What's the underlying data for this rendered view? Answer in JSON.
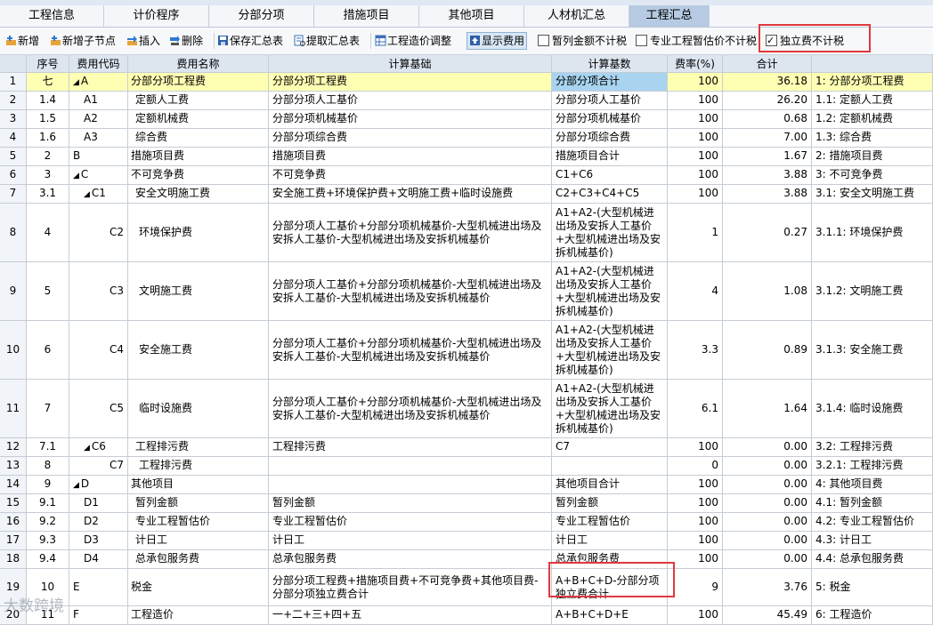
{
  "tabs": [
    "工程信息",
    "计价程序",
    "分部分项",
    "措施项目",
    "其他项目",
    "人材机汇总",
    "工程汇总"
  ],
  "active_tab": 6,
  "toolbar": {
    "add": "新增",
    "add_child": "新增子节点",
    "insert": "插入",
    "delete": "删除",
    "save_summary": "保存汇总表",
    "extract_summary": "提取汇总表",
    "cost_adjust": "工程造价调整",
    "show_fee": "显示费用",
    "provisional_no_tax": "暂列金额不计税",
    "special_no_tax": "专业工程暂估价不计税",
    "independent_no_tax": "独立费不计税"
  },
  "columns": [
    "序号",
    "费用代码",
    "费用名称",
    "计算基础",
    "计算基数",
    "费率(%)",
    "合计"
  ],
  "rows": [
    {
      "rn": "1",
      "seq": "七",
      "code": "A",
      "name": "分部分项工程费",
      "basis": "分部分项工程费",
      "base": "分部分项合计",
      "rate": "100",
      "total": "36.18",
      "desc": "1: 分部分项工程费",
      "indent": 0,
      "tri": "◢",
      "hl": true
    },
    {
      "rn": "2",
      "seq": "1.4",
      "code": "A1",
      "name": "定额人工费",
      "basis": "分部分项人工基价",
      "base": "分部分项人工基价",
      "rate": "100",
      "total": "26.20",
      "desc": "1.1: 定额人工费",
      "indent": 1
    },
    {
      "rn": "3",
      "seq": "1.5",
      "code": "A2",
      "name": "定额机械费",
      "basis": "分部分项机械基价",
      "base": "分部分项机械基价",
      "rate": "100",
      "total": "0.68",
      "desc": "1.2: 定额机械费",
      "indent": 1
    },
    {
      "rn": "4",
      "seq": "1.6",
      "code": "A3",
      "name": "综合费",
      "basis": "分部分项综合费",
      "base": "分部分项综合费",
      "rate": "100",
      "total": "7.00",
      "desc": "1.3: 综合费",
      "indent": 1
    },
    {
      "rn": "5",
      "seq": "2",
      "code": "B",
      "name": "措施项目费",
      "basis": "措施项目费",
      "base": "措施项目合计",
      "rate": "100",
      "total": "1.67",
      "desc": "2: 措施项目费",
      "indent": 0
    },
    {
      "rn": "6",
      "seq": "3",
      "code": "C",
      "name": "不可竞争费",
      "basis": "不可竞争费",
      "base": "C1+C6",
      "rate": "100",
      "total": "3.88",
      "desc": "3: 不可竞争费",
      "indent": 0,
      "tri": "◢"
    },
    {
      "rn": "7",
      "seq": "3.1",
      "code": "C1",
      "name": "安全文明施工费",
      "basis": "安全施工费+环境保护费+文明施工费+临时设施费",
      "base": "C2+C3+C4+C5",
      "rate": "100",
      "total": "3.88",
      "desc": "3.1: 安全文明施工费",
      "indent": 1,
      "tri": "◢"
    },
    {
      "rn": "8",
      "seq": "4",
      "code": "C2",
      "name": "环境保护费",
      "basis": "分部分项人工基价+分部分项机械基价-大型机械进出场及安拆人工基价-大型机械进出场及安拆机械基价",
      "base": "A1+A2-(大型机械进出场及安拆人工基价+大型机械进出场及安拆机械基价)",
      "rate": "1",
      "total": "0.27",
      "desc": "3.1.1: 环境保护费",
      "indent": 2,
      "tall": true
    },
    {
      "rn": "9",
      "seq": "5",
      "code": "C3",
      "name": "文明施工费",
      "basis": "分部分项人工基价+分部分项机械基价-大型机械进出场及安拆人工基价-大型机械进出场及安拆机械基价",
      "base": "A1+A2-(大型机械进出场及安拆人工基价+大型机械进出场及安拆机械基价)",
      "rate": "4",
      "total": "1.08",
      "desc": "3.1.2: 文明施工费",
      "indent": 2,
      "tall": true
    },
    {
      "rn": "10",
      "seq": "6",
      "code": "C4",
      "name": "安全施工费",
      "basis": "分部分项人工基价+分部分项机械基价-大型机械进出场及安拆人工基价-大型机械进出场及安拆机械基价",
      "base": "A1+A2-(大型机械进出场及安拆人工基价+大型机械进出场及安拆机械基价)",
      "rate": "3.3",
      "total": "0.89",
      "desc": "3.1.3: 安全施工费",
      "indent": 2,
      "tall": true
    },
    {
      "rn": "11",
      "seq": "7",
      "code": "C5",
      "name": "临时设施费",
      "basis": "分部分项人工基价+分部分项机械基价-大型机械进出场及安拆人工基价-大型机械进出场及安拆机械基价",
      "base": "A1+A2-(大型机械进出场及安拆人工基价+大型机械进出场及安拆机械基价)",
      "rate": "6.1",
      "total": "1.64",
      "desc": "3.1.4: 临时设施费",
      "indent": 2,
      "tall": true
    },
    {
      "rn": "12",
      "seq": "7.1",
      "code": "C6",
      "name": "工程排污费",
      "basis": "工程排污费",
      "base": "C7",
      "rate": "100",
      "total": "0.00",
      "desc": "3.2: 工程排污费",
      "indent": 1,
      "tri": "◢"
    },
    {
      "rn": "13",
      "seq": "8",
      "code": "C7",
      "name": "工程排污费",
      "basis": "",
      "base": "",
      "rate": "0",
      "total": "0.00",
      "desc": "3.2.1: 工程排污费",
      "indent": 2
    },
    {
      "rn": "14",
      "seq": "9",
      "code": "D",
      "name": "其他项目",
      "basis": "",
      "base": "其他项目合计",
      "rate": "100",
      "total": "0.00",
      "desc": "4: 其他项目费",
      "indent": 0,
      "tri": "◢"
    },
    {
      "rn": "15",
      "seq": "9.1",
      "code": "D1",
      "name": "暂列金额",
      "basis": "暂列金额",
      "base": "暂列金额",
      "rate": "100",
      "total": "0.00",
      "desc": "4.1: 暂列金额",
      "indent": 1
    },
    {
      "rn": "16",
      "seq": "9.2",
      "code": "D2",
      "name": "专业工程暂估价",
      "basis": "专业工程暂估价",
      "base": "专业工程暂估价",
      "rate": "100",
      "total": "0.00",
      "desc": "4.2: 专业工程暂估价",
      "indent": 1
    },
    {
      "rn": "17",
      "seq": "9.3",
      "code": "D3",
      "name": "计日工",
      "basis": "计日工",
      "base": "计日工",
      "rate": "100",
      "total": "0.00",
      "desc": "4.3: 计日工",
      "indent": 1
    },
    {
      "rn": "18",
      "seq": "9.4",
      "code": "D4",
      "name": "总承包服务费",
      "basis": "总承包服务费",
      "base": "总承包服务费",
      "rate": "100",
      "total": "0.00",
      "desc": "4.4: 总承包服务费",
      "indent": 1
    },
    {
      "rn": "19",
      "seq": "10",
      "code": "E",
      "name": "税金",
      "basis": "分部分项工程费+措施项目费+不可竞争费+其他项目费-分部分项独立费合计",
      "base": "A+B+C+D-分部分项独立费合计",
      "rate": "9",
      "total": "3.76",
      "desc": "5: 税金",
      "indent": 0,
      "mid": true
    },
    {
      "rn": "20",
      "seq": "11",
      "code": "F",
      "name": "工程造价",
      "basis": "一+二+三+四+五",
      "base": "A+B+C+D+E",
      "rate": "100",
      "total": "45.49",
      "desc": "6: 工程造价",
      "indent": 0
    }
  ],
  "watermark": "大数跨境"
}
